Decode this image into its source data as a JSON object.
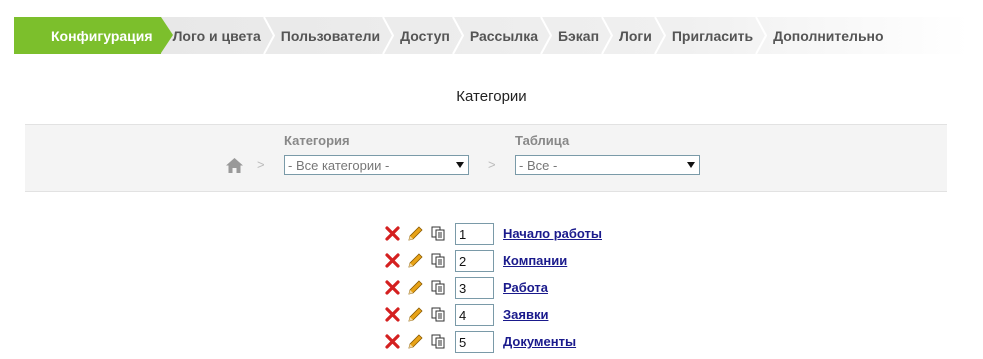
{
  "tabs": [
    {
      "label": "Конфигурация",
      "active": true
    },
    {
      "label": "Лого и цвета",
      "active": false
    },
    {
      "label": "Пользователи",
      "active": false
    },
    {
      "label": "Доступ",
      "active": false
    },
    {
      "label": "Рассылка",
      "active": false
    },
    {
      "label": "Бэкап",
      "active": false
    },
    {
      "label": "Логи",
      "active": false
    },
    {
      "label": "Пригласить",
      "active": false
    },
    {
      "label": "Дополнительно",
      "active": false
    }
  ],
  "page_title": "Категории",
  "filter": {
    "home_icon": "home-icon",
    "separator": ">",
    "category_label": "Категория",
    "category_value": "- Все категории -",
    "table_label": "Таблица",
    "table_value": "- Все -"
  },
  "items": [
    {
      "order": "1",
      "name": "Начало работы"
    },
    {
      "order": "2",
      "name": "Компании"
    },
    {
      "order": "3",
      "name": "Работа"
    },
    {
      "order": "4",
      "name": "Заявки"
    },
    {
      "order": "5",
      "name": "Документы"
    }
  ],
  "colors": {
    "accent": "#7cbf2c",
    "link": "#1a1a8c",
    "delete": "#d42020",
    "edit": "#e8a317"
  }
}
